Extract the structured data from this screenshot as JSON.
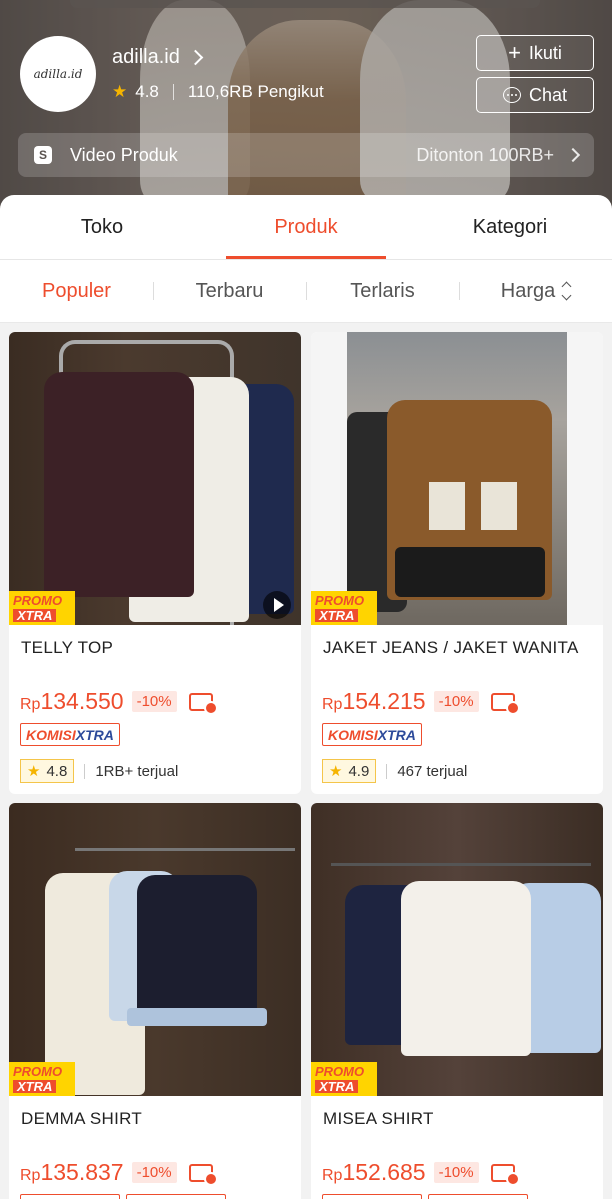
{
  "shop": {
    "name": "adilla.id",
    "logo_text": "adilla.id",
    "rating": "4.8",
    "followers": "110,6RB Pengikut",
    "follow_label": "Ikuti",
    "chat_label": "Chat",
    "video_label": "Video Produk",
    "video_views": "Ditonton 100RB+",
    "video_icon": "S"
  },
  "tabs": [
    {
      "label": "Toko",
      "active": false
    },
    {
      "label": "Produk",
      "active": true
    },
    {
      "label": "Kategori",
      "active": false
    }
  ],
  "sort": [
    {
      "label": "Populer",
      "active": true
    },
    {
      "label": "Terbaru",
      "active": false
    },
    {
      "label": "Terlaris",
      "active": false
    },
    {
      "label": "Harga",
      "active": false
    }
  ],
  "badges": {
    "promo_top": "PROMO",
    "promo_bottom": "XTRA",
    "komisi_a": "KOMISI",
    "komisi_b": "XTRA"
  },
  "products": [
    {
      "name": "TELLY TOP",
      "price_prefix": "Rp",
      "price": "134.550",
      "discount": "-10%",
      "rating": "4.8",
      "sold": "1RB+ terjual",
      "has_video": true
    },
    {
      "name": "JAKET JEANS  / JAKET WANITA",
      "price_prefix": "Rp",
      "price": "154.215",
      "discount": "-10%",
      "rating": "4.9",
      "sold": "467 terjual",
      "has_video": false
    },
    {
      "name": "DEMMA SHIRT",
      "price_prefix": "Rp",
      "price": "135.837",
      "discount": "-10%"
    },
    {
      "name": "MISEA SHIRT",
      "price_prefix": "Rp",
      "price": "152.685",
      "discount": "-10%"
    }
  ],
  "colors": {
    "accent": "#ee4d2d",
    "star": "#f5b400",
    "promo_yellow": "#ffd400",
    "komisi_blue": "#2c4a9a"
  }
}
